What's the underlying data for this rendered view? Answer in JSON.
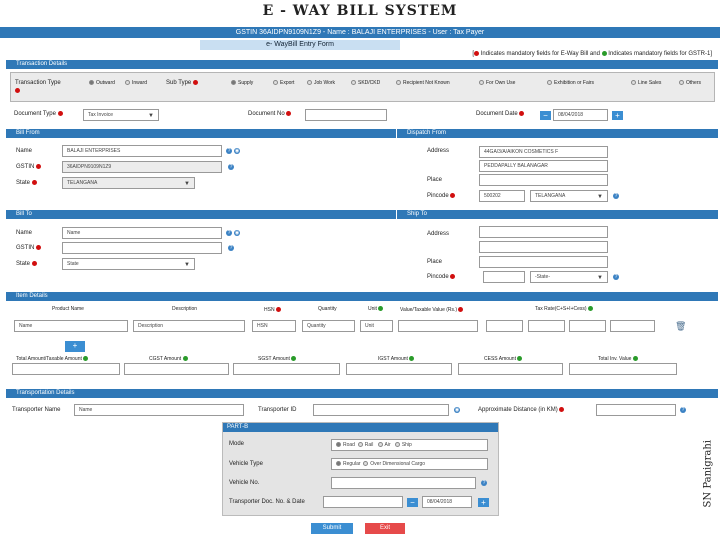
{
  "app_title": "E - WAY BILL SYSTEM",
  "user_bar": "GSTIN 36AIDPN9109N1Z9 - Name : BALAJI ENTERPRISES - User : Tax Payer",
  "form_title": "e- WayBill Entry Form",
  "mandatory_note": {
    "part1": "Indicates mandatory fields for E-Way Bill and",
    "part2": "Indicates mandatory fields for GSTR-1]",
    "open": "["
  },
  "transaction": {
    "section": "Transaction Details",
    "type_label": "Transaction Type",
    "type_options": [
      "Outward",
      "Inward"
    ],
    "subtype_label": "Sub Type",
    "subtype_options": [
      "Supply",
      "Export",
      "Job Work",
      "SKD/CKD",
      "Recipient Not Known",
      "For Own Use",
      "Exhibition or Fairs",
      "Line Sales",
      "Others"
    ],
    "doc_type_label": "Document Type",
    "doc_type_value": "Tax Invoice",
    "doc_no_label": "Document No",
    "doc_date_label": "Document Date",
    "doc_date_value": "08/04/2018"
  },
  "bill_from": {
    "section": "Bill From",
    "name_label": "Name",
    "name_value": "BALAJI ENTERPRISES",
    "gstin_label": "GSTIN",
    "gstin_value": "36AIDPN9109N1Z9",
    "state_label": "State",
    "state_value": "TELANGANA"
  },
  "dispatch_from": {
    "section": "Dispatch From",
    "address_label": "Address",
    "address1": "44GA/3/A/AIKON COSMETICS F",
    "address2": "PEDDAPALLY BALANAGAR",
    "place_label": "Place",
    "pincode_label": "Pincode",
    "pincode_value": "500202",
    "state_value": "TELANGANA"
  },
  "bill_to": {
    "section": "Bill To",
    "name_label": "Name",
    "name_placeholder": "Name",
    "gstin_label": "GSTIN",
    "state_label": "State",
    "state_value": "State"
  },
  "ship_to": {
    "section": "Ship To",
    "address_label": "Address",
    "place_label": "Place",
    "pincode_label": "Pincode",
    "state_value": "-State-"
  },
  "items": {
    "section": "Item Details",
    "headers": [
      "Product Name",
      "Description",
      "HSN",
      "Quantity",
      "Unit",
      "Value/Taxable Value (Rs.)",
      "Tax Rate(C+S+I+Cess)"
    ],
    "placeholders": [
      "Name",
      "Description",
      "HSN",
      "Quantity",
      "Unit"
    ],
    "totals": [
      "Total Amount/Taxable Amount",
      "CGST Amount",
      "SGST Amount",
      "IGST Amount",
      "CESS Amount",
      "Total Inv. Value"
    ]
  },
  "transport": {
    "section": "Transportation Details",
    "transporter_name_label": "Transporter Name",
    "transporter_name_placeholder": "Name",
    "transporter_id_label": "Transporter ID",
    "distance_label": "Approximate Distance (in KM)"
  },
  "partb": {
    "title": "PART-B",
    "mode_label": "Mode",
    "modes": [
      "Road",
      "Rail",
      "Air",
      "Ship"
    ],
    "vehicle_type_label": "Vehicle Type",
    "vehicle_types": [
      "Regular",
      "Over Dimensional Cargo"
    ],
    "vehicle_no_label": "Vehicle No.",
    "doc_label": "Transporter Doc. No. & Date",
    "doc_date_value": "08/04/2018"
  },
  "buttons": {
    "submit": "Submit",
    "exit": "Exit",
    "plus": "+",
    "minus": "−"
  },
  "credit": "SN Panigrahi",
  "colors": {
    "primary": "#2f78b7",
    "mandatory_red": "#d10f0f",
    "gstr_green": "#2a9b2a",
    "exit_red": "#e64a4a"
  }
}
